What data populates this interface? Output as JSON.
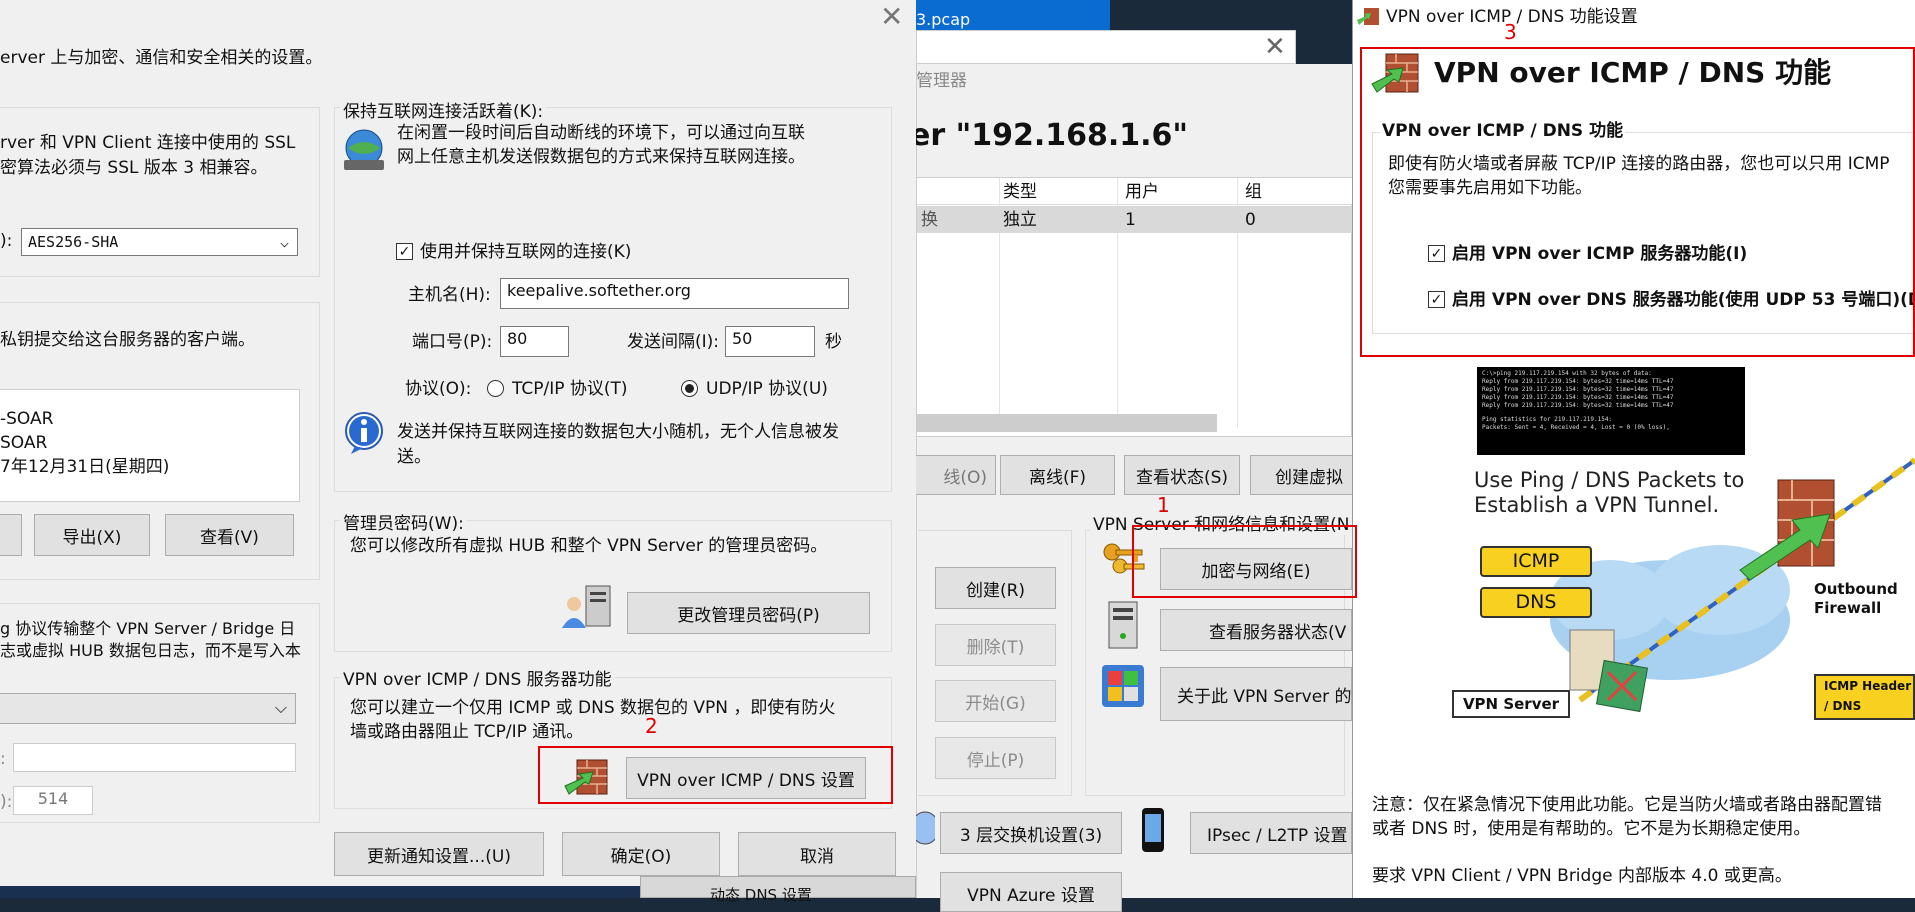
{
  "background_window": {
    "tab_title": "3.pcap",
    "manager_title": "管理器",
    "server_title": "er \"192.168.1.6\"",
    "table_headers": [
      "类型",
      "用户",
      "组"
    ],
    "table_row": {
      "col0": "换",
      "type": "独立",
      "users": "1",
      "groups": "0"
    },
    "buttons": {
      "online": "线(O)",
      "offline": "离线(F)",
      "status": "查看状态(S)",
      "create_virtual": "创建虚拟",
      "create": "创建(R)",
      "delete": "删除(T)",
      "start": "开始(G)",
      "stop": "停止(P)",
      "encrypt_network": "加密与网络(E)",
      "view_server_status": "查看服务器状态(V",
      "about": "关于此 VPN Server 的",
      "l3_switch": "3 层交换机设置(3)",
      "ipsec": "IPsec / L2TP 设置",
      "vpn_azure": "VPN Azure 设置",
      "dynamic_dns": "动态 DNS 设置"
    },
    "group_label": "VPN Server 和网络信息和设置(N"
  },
  "encryption_dialog": {
    "intro": "erver 上与加密、通信和安全相关的设置。",
    "ssl_desc_1": "rver 和 VPN Client 连接中使用的 SSL",
    "ssl_desc_2": "密算法必须与 SSL 版本 3 相兼容。",
    "cipher_label": "):",
    "cipher_value": "AES256-SHA",
    "cert_desc": "私钥提交给这台服务器的客户端。",
    "cert_line1": "-SOAR",
    "cert_line2": "SOAR",
    "cert_line3": "7年12月31日(星期四)",
    "export_button": "导出(X)",
    "view_button": "查看(V)",
    "syslog_desc_1": "g 协议传输整个 VPN Server / Bridge 日",
    "syslog_desc_2": "志或虚拟 HUB 数据包日志，而不是写入本",
    "host_label": ":",
    "port_label": "):",
    "port_value": "514",
    "keepalive": {
      "group_title": "保持互联网连接活跃着(K):",
      "desc_1": "在闲置一段时间后自动断线的环境下，可以通过向互联",
      "desc_2": "网上任意主机发送假数据包的方式来保持互联网连接。",
      "checkbox_label": "使用并保持互联网的连接(K)",
      "host_label": "主机名(H):",
      "host_value": "keepalive.softether.org",
      "port_label": "端口号(P):",
      "port_value": "80",
      "interval_label": "发送间隔(I):",
      "interval_value": "50",
      "interval_unit": "秒",
      "protocol_label": "协议(O):",
      "tcp_label": "TCP/IP 协议(T)",
      "udp_label": "UDP/IP 协议(U)",
      "info_1": "发送并保持互联网连接的数据包大小随机，无个人信息被发",
      "info_2": "送。"
    },
    "admin_pw": {
      "group_title": "管理员密码(W):",
      "desc": "您可以修改所有虚拟 HUB 和整个 VPN Server 的管理员密码。",
      "button": "更改管理员密码(P)"
    },
    "vpn_icmp": {
      "group_title": "VPN over ICMP / DNS 服务器功能",
      "desc_1": "您可以建立一个仅用 ICMP 或 DNS 数据包的 VPN ，即使有防火",
      "desc_2": "墙或路由器阻止 TCP/IP 通讯。",
      "button": "VPN over ICMP / DNS 设置"
    },
    "bottom_buttons": {
      "update": "更新通知设置...(U)",
      "ok": "确定(O)",
      "cancel": "取消"
    }
  },
  "icmp_dialog": {
    "title": "VPN over ICMP / DNS 功能设置",
    "header": "VPN over ICMP / DNS 功能",
    "group_title": "VPN over ICMP / DNS 功能",
    "desc_1": "即使有防火墙或者屏蔽 TCP/IP 连接的路由器，您也可以只用 ICMP",
    "desc_2": "您需要事先启用如下功能。",
    "check_icmp": "启用 VPN over ICMP 服务器功能(I)",
    "check_dns": "启用 VPN over DNS 服务器功能(使用 UDP 53 号端口)(D",
    "diagram": {
      "terminal_1": "C:\\>ping 219.117.219.154 with 32 bytes of data:",
      "terminal_2": "Reply from 219.117.219.154: bytes=32 time=14ms TTL=47",
      "terminal_3": "Reply from 219.117.219.154: bytes=32 time=14ms TTL=47",
      "terminal_4": "Reply from 219.117.219.154: bytes=32 time=14ms TTL=47",
      "terminal_5": "Reply from 219.117.219.154: bytes=32 time=14ms TTL=47",
      "terminal_6": "Ping statistics for 219.117.219.154:",
      "terminal_7": "Packets: Sent = 4, Received = 4, Lost = 0 (0% loss),",
      "caption_1": "Use Ping / DNS Packets to",
      "caption_2": "Establish a VPN Tunnel.",
      "icmp_tag": "ICMP",
      "dns_tag": "DNS",
      "firewall_1": "Outbound",
      "firewall_2": "Firewall",
      "server_label": "VPN Server",
      "header_label_1": "ICMP Header",
      "header_label_2": "/ DNS Header"
    },
    "note_1": "注意：仅在紧急情况下使用此功能。它是当防火墙或者路由器配置错",
    "note_2": "或者 DNS 时，使用是有帮助的。它不是为长期稳定使用。",
    "requirement": "要求 VPN Client / VPN Bridge 内部版本 4.0 或更高。"
  },
  "annotations": {
    "one": "1",
    "two": "2",
    "three": "3"
  }
}
